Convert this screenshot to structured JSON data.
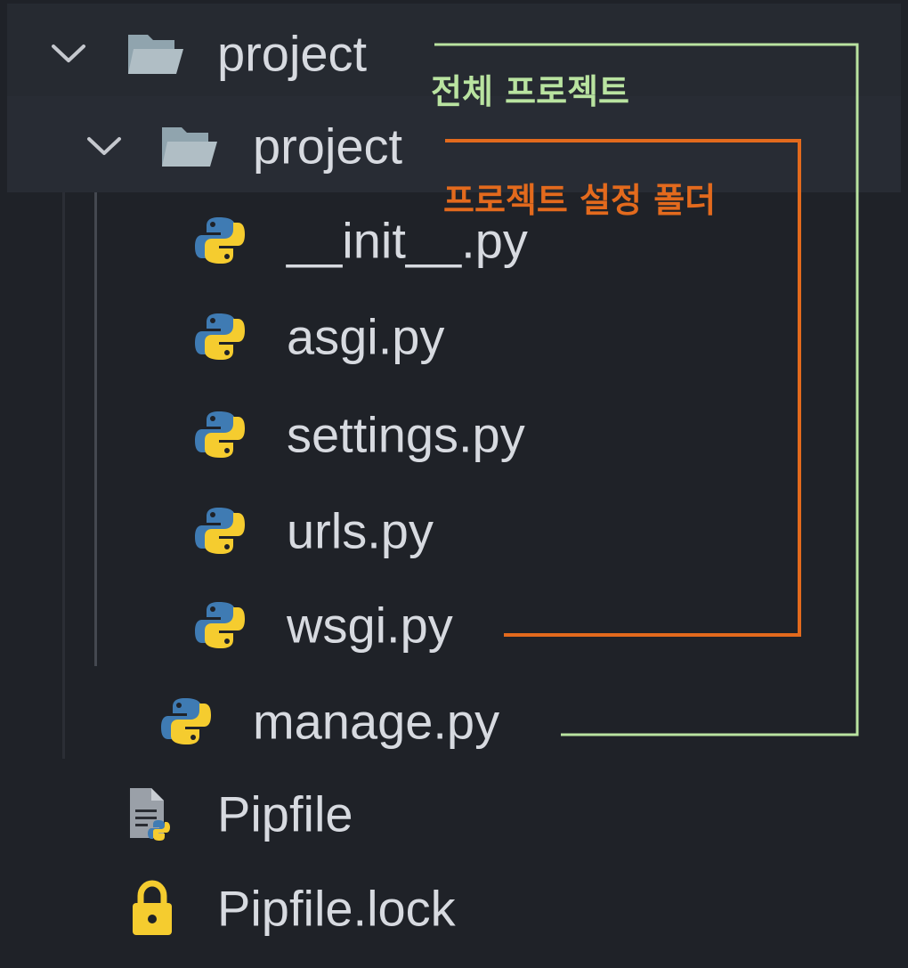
{
  "explorer": {
    "tree": [
      {
        "label": "project",
        "type": "folder",
        "expanded": true,
        "icon": "folder-open-icon"
      },
      {
        "label": "project",
        "type": "folder",
        "expanded": true,
        "icon": "folder-open-icon"
      },
      {
        "label": "__init__.py",
        "type": "file",
        "icon": "python-icon"
      },
      {
        "label": "asgi.py",
        "type": "file",
        "icon": "python-icon"
      },
      {
        "label": "settings.py",
        "type": "file",
        "icon": "python-icon"
      },
      {
        "label": "urls.py",
        "type": "file",
        "icon": "python-icon"
      },
      {
        "label": "wsgi.py",
        "type": "file",
        "icon": "python-icon"
      },
      {
        "label": "manage.py",
        "type": "file",
        "icon": "python-icon"
      },
      {
        "label": "Pipfile",
        "type": "file",
        "icon": "pipfile-icon"
      },
      {
        "label": "Pipfile.lock",
        "type": "file",
        "icon": "lock-icon"
      }
    ]
  },
  "annotations": {
    "whole_project": "전체 프로젝트",
    "settings_folder": "프로젝트 설정 폴더"
  },
  "colors": {
    "background": "#1f2228",
    "text": "#d7dae0",
    "whole_project_bracket": "#b9e3a0",
    "settings_folder_bracket": "#e36a1d",
    "python_blue": "#3f7bb3",
    "python_yellow": "#f5cc2f"
  }
}
